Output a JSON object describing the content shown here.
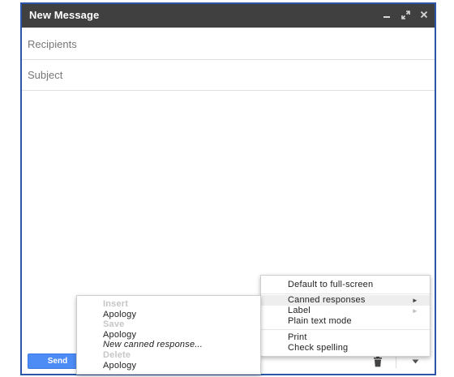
{
  "window": {
    "title": "New Message",
    "controls": {
      "minimize_icon": "minimize-icon",
      "popout_icon": "popout-icon",
      "close_icon": "close-icon"
    },
    "title_bar_color": "#404040",
    "border_color": "#2c55a8"
  },
  "fields": {
    "recipients_placeholder": "Recipients",
    "subject_placeholder": "Subject"
  },
  "toolbar": {
    "send_label": "Send",
    "send_color": "#4d8cf5",
    "trash_icon": "trash-icon",
    "more_icon": "more-options-icon"
  },
  "more_menu": {
    "items": [
      {
        "label": "Default to full-screen"
      },
      {
        "label": "Canned responses",
        "submenu": true,
        "highlighted": true
      },
      {
        "label": "Label",
        "submenu": true
      },
      {
        "label": "Plain text mode"
      },
      {
        "label": "Print"
      },
      {
        "label": "Check spelling"
      }
    ],
    "submenu_arrow": "►"
  },
  "canned_menu": {
    "insert_heading": "Insert",
    "insert_items": [
      "Apology"
    ],
    "save_heading": "Save",
    "save_items": [
      "Apology",
      "New canned response..."
    ],
    "delete_heading": "Delete",
    "delete_items": [
      "Apology"
    ]
  }
}
